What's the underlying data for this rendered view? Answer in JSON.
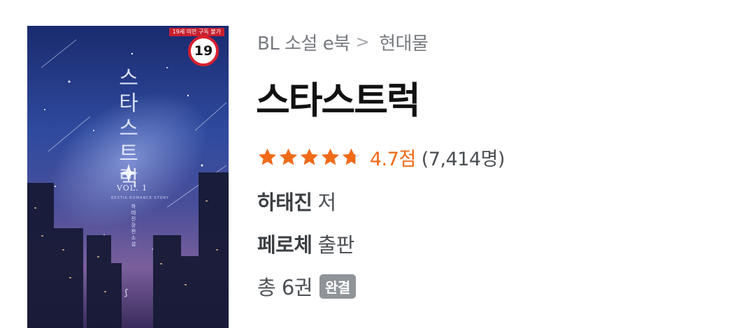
{
  "cover": {
    "age_banner": "19세 미만 구독 불가",
    "age_badge": "19",
    "title_vertical": "스타스트럭",
    "volume": "VOL. 1",
    "subtitle": "BESTIA ROMANCE STORY",
    "author_vertical": "하태진 장편소설"
  },
  "breadcrumb": {
    "category": "BL 소설 e북",
    "separator": ">",
    "genre": "현대물"
  },
  "book": {
    "title": "스타스트럭",
    "rating": 4.7,
    "rating_text": "4.7점",
    "rating_count": "(7,414명)",
    "author_name": "하태진",
    "author_suffix": "저",
    "publisher_name": "페로체",
    "publisher_suffix": "출판",
    "volumes_text": "총 6권",
    "status_badge": "완결"
  },
  "colors": {
    "star": "#f06a18",
    "score": "#f06a18",
    "badge_bg": "#8f9499",
    "title": "#111111"
  }
}
